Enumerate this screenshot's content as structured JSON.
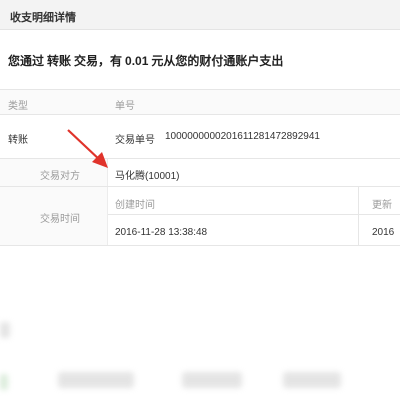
{
  "panel": {
    "title": "收支明细详情"
  },
  "summary": {
    "prefix": "您通过",
    "type": "转账",
    "mid": "交易，有",
    "amount": "0.01",
    "suffix": "元从您的财付通账户支出"
  },
  "table": {
    "col_type_header": "类型",
    "col_number_header": "单号",
    "type_value": "转账",
    "number_label": "交易单号",
    "number_value": "100000000020161128147289294​1",
    "counterparty_label": "交易对方",
    "counterparty_value": "马化腾(10001)",
    "time_label": "交易时间",
    "created_header": "创建时间",
    "created_value": "2016-11-28 13:38:48",
    "updated_header_partial": "更新",
    "updated_value_partial": "2016"
  },
  "annotation": {
    "arrow_color": "#e0332b"
  }
}
